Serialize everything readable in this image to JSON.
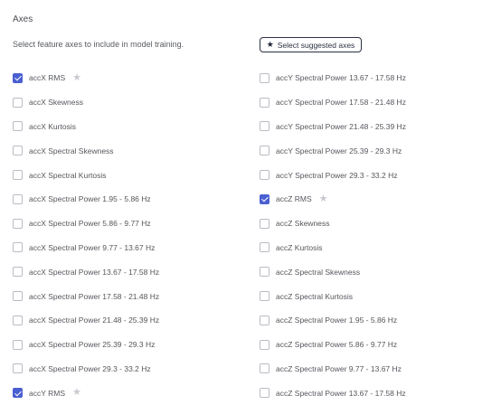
{
  "header": {
    "title": "Axes",
    "description": "Select feature axes to include in model training.",
    "suggest_button_label": "Select suggested axes",
    "suggest_button_icon": "star-icon"
  },
  "colors": {
    "accent": "#4a5fd1",
    "button_border": "#2d3142",
    "star_muted": "#c8cad0"
  },
  "axes_left": [
    {
      "label": "accX RMS",
      "checked": true,
      "starred": true
    },
    {
      "label": "accX Skewness",
      "checked": false,
      "starred": false
    },
    {
      "label": "accX Kurtosis",
      "checked": false,
      "starred": false
    },
    {
      "label": "accX Spectral Skewness",
      "checked": false,
      "starred": false
    },
    {
      "label": "accX Spectral Kurtosis",
      "checked": false,
      "starred": false
    },
    {
      "label": "accX Spectral Power 1.95 - 5.86 Hz",
      "checked": false,
      "starred": false
    },
    {
      "label": "accX Spectral Power 5.86 - 9.77 Hz",
      "checked": false,
      "starred": false
    },
    {
      "label": "accX Spectral Power 9.77 - 13.67 Hz",
      "checked": false,
      "starred": false
    },
    {
      "label": "accX Spectral Power 13.67 - 17.58 Hz",
      "checked": false,
      "starred": false
    },
    {
      "label": "accX Spectral Power 17.58 - 21.48 Hz",
      "checked": false,
      "starred": false
    },
    {
      "label": "accX Spectral Power 21.48 - 25.39 Hz",
      "checked": false,
      "starred": false
    },
    {
      "label": "accX Spectral Power 25.39 - 29.3 Hz",
      "checked": false,
      "starred": false
    },
    {
      "label": "accX Spectral Power 29.3 - 33.2 Hz",
      "checked": false,
      "starred": false
    },
    {
      "label": "accY RMS",
      "checked": true,
      "starred": true
    }
  ],
  "axes_right": [
    {
      "label": "accY Spectral Power 13.67 - 17.58 Hz",
      "checked": false,
      "starred": false
    },
    {
      "label": "accY Spectral Power 17.58 - 21.48 Hz",
      "checked": false,
      "starred": false
    },
    {
      "label": "accY Spectral Power 21.48 - 25.39 Hz",
      "checked": false,
      "starred": false
    },
    {
      "label": "accY Spectral Power 25.39 - 29.3 Hz",
      "checked": false,
      "starred": false
    },
    {
      "label": "accY Spectral Power 29.3 - 33.2 Hz",
      "checked": false,
      "starred": false
    },
    {
      "label": "accZ RMS",
      "checked": true,
      "starred": true
    },
    {
      "label": "accZ Skewness",
      "checked": false,
      "starred": false
    },
    {
      "label": "accZ Kurtosis",
      "checked": false,
      "starred": false
    },
    {
      "label": "accZ Spectral Skewness",
      "checked": false,
      "starred": false
    },
    {
      "label": "accZ Spectral Kurtosis",
      "checked": false,
      "starred": false
    },
    {
      "label": "accZ Spectral Power 1.95 - 5.86 Hz",
      "checked": false,
      "starred": false
    },
    {
      "label": "accZ Spectral Power 5.86 - 9.77 Hz",
      "checked": false,
      "starred": false
    },
    {
      "label": "accZ Spectral Power 9.77 - 13.67 Hz",
      "checked": false,
      "starred": false
    },
    {
      "label": "accZ Spectral Power 13.67 - 17.58 Hz",
      "checked": false,
      "starred": false
    }
  ]
}
